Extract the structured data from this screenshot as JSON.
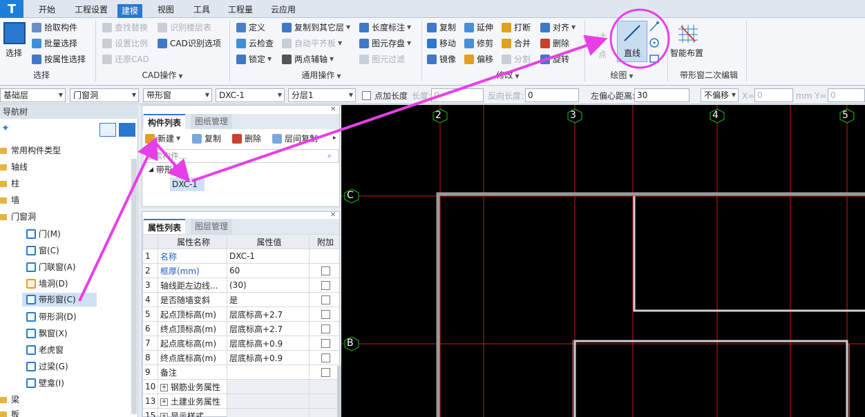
{
  "menubar": {
    "items": [
      "开始",
      "工程设置",
      "建模",
      "视图",
      "工具",
      "工程量",
      "云应用"
    ],
    "active": "建模"
  },
  "ribbon": {
    "select_group": {
      "big_button": "选择",
      "items": [
        "拾取构件",
        "批量选择",
        "按属性选择"
      ],
      "title": "选择"
    },
    "cad_group": {
      "items": [
        "查找替换",
        "识别楼层表",
        "设置比例",
        "CAD识别选项",
        "还原CAD"
      ],
      "title": "CAD操作"
    },
    "general_group": {
      "items": [
        "定义",
        "复制到其它层",
        "长度标注",
        "云检查",
        "自动平齐板",
        "图元存盘",
        "锁定",
        "两点辅轴",
        "图元过滤"
      ],
      "title": "通用操作"
    },
    "modify_group": {
      "items": [
        "复制",
        "延伸",
        "打断",
        "对齐",
        "移动",
        "修剪",
        "合并",
        "删除",
        "镜像",
        "偏移",
        "分割",
        "旋转"
      ],
      "title": "修改"
    },
    "draw_group": {
      "point": "点",
      "line": "直线",
      "title": "绘图"
    },
    "smart_group": {
      "label": "智能布置",
      "title": "带形窗二次编辑"
    }
  },
  "toolbar": {
    "floor": "基础层",
    "category": "门窗洞",
    "type": "带形窗",
    "component": "DXC-1",
    "layer": "分层1",
    "point_length_label": "点加长度",
    "length_label": "长度:",
    "length_value": "0",
    "reverse_length_label": "反向长度:",
    "reverse_length_value": "0",
    "left_offset_label": "左偏心距离:",
    "left_offset_value": "30",
    "offset_mode": "不偏移",
    "x_label": "X=",
    "x_value": "0",
    "mm_y_label": "mm Y=",
    "y_value": "0"
  },
  "nav": {
    "title": "导航树",
    "items": [
      "常用构件类型",
      "轴线",
      "柱",
      "墙",
      "门窗洞"
    ],
    "sub_items": [
      "门(M)",
      "窗(C)",
      "门联窗(A)",
      "墙洞(D)",
      "带形窗(C)",
      "带形洞(D)",
      "飘窗(X)",
      "老虎窗",
      "过梁(G)",
      "壁龛(I)"
    ],
    "bottom_items": [
      "梁",
      "板"
    ]
  },
  "component_list": {
    "tabs": [
      "构件列表",
      "图纸管理"
    ],
    "new_label": "新建",
    "copy_label": "复制",
    "delete_label": "删除",
    "floor_copy_label": "层间复制",
    "search_placeholder": "搜索构件...",
    "tree_parent": "带形窗",
    "tree_child": "DXC-1"
  },
  "property_list": {
    "tabs": [
      "属性列表",
      "图层管理"
    ],
    "headers": [
      "属性名称",
      "属性值",
      "附加"
    ],
    "rows": [
      {
        "num": "1",
        "name": "名称",
        "value": "DXC-1"
      },
      {
        "num": "2",
        "name": "框厚(mm)",
        "value": "60"
      },
      {
        "num": "3",
        "name": "轴线距左边线...",
        "value": "(30)"
      },
      {
        "num": "4",
        "name": "是否随墙变斜",
        "value": "是"
      },
      {
        "num": "5",
        "name": "起点顶标高(m)",
        "value": "层底标高+2.7"
      },
      {
        "num": "6",
        "name": "终点顶标高(m)",
        "value": "层底标高+2.7"
      },
      {
        "num": "7",
        "name": "起点底标高(m)",
        "value": "层底标高+0.9"
      },
      {
        "num": "8",
        "name": "终点底标高(m)",
        "value": "层底标高+0.9"
      },
      {
        "num": "9",
        "name": "备注",
        "value": ""
      },
      {
        "num": "10",
        "name": "钢筋业务属性",
        "value": ""
      },
      {
        "num": "13",
        "name": "土建业务属性",
        "value": ""
      },
      {
        "num": "15",
        "name": "显示样式",
        "value": ""
      }
    ]
  },
  "canvas": {
    "axis_x": [
      "2",
      "3",
      "4",
      "5"
    ],
    "axis_y": [
      "C",
      "B"
    ]
  },
  "colors": {
    "accent": "#2a78cf",
    "arrow": "#e83ee8",
    "grid": "#d01818"
  }
}
